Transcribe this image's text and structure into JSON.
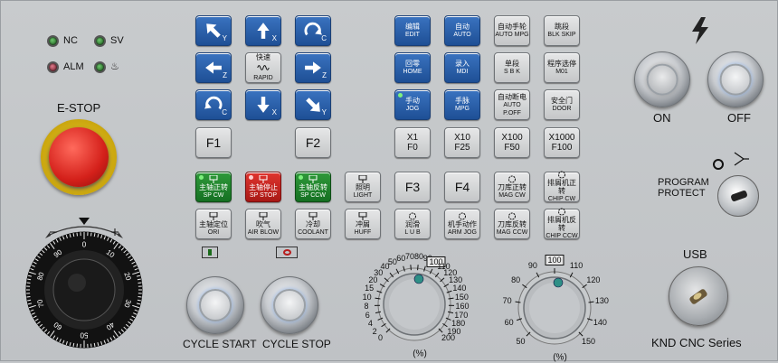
{
  "status_leds": [
    {
      "label": "NC",
      "color": "#2f7a2f"
    },
    {
      "label": "SV",
      "color": "#2f7a2f"
    },
    {
      "label": "ALM",
      "color": "#8a2a3a"
    },
    {
      "label": "♨",
      "color": "#2f7a2f"
    }
  ],
  "estop": {
    "label": "E-STOP"
  },
  "feed_dial_ticks": [
    "0",
    "10",
    "20",
    "30",
    "40",
    "50",
    "60",
    "70",
    "80",
    "90"
  ],
  "cycle": {
    "start_label": "CYCLE START",
    "stop_label": "CYCLE STOP"
  },
  "power": {
    "on_label": "ON",
    "off_label": "OFF"
  },
  "program_protect": {
    "label_line1": "PROGRAM",
    "label_line2": "PROTECT"
  },
  "usb": {
    "label": "USB"
  },
  "brand": {
    "label": "KND CNC Series"
  },
  "jog_keys": [
    {
      "icon": "arrow-up-left",
      "sub": "Y"
    },
    {
      "icon": "arrow-up",
      "sub": "X"
    },
    {
      "icon": "rotate-cw",
      "sub": "C"
    },
    {
      "icon": "arrow-left",
      "sub": "Z"
    },
    {
      "cn": "快速",
      "en": "RAPID",
      "icon": "rapid"
    },
    {
      "icon": "arrow-right",
      "sub": "Z"
    },
    {
      "icon": "rotate-ccw",
      "sub": "C"
    },
    {
      "icon": "arrow-down",
      "sub": "X"
    },
    {
      "icon": "arrow-down-right",
      "sub": "Y"
    }
  ],
  "fkeys": {
    "f1": "F1",
    "f2": "F2",
    "f3": "F3",
    "f4": "F4"
  },
  "mode_keys": [
    {
      "cn": "编辑",
      "en": "EDIT",
      "style": "blue"
    },
    {
      "cn": "自动",
      "en": "AUTO",
      "style": "blue"
    },
    {
      "cn": "自动手轮",
      "en": "AUTO MPG",
      "style": "gray"
    },
    {
      "cn": "跳段",
      "en": "BLK SKIP",
      "style": "gray"
    },
    {
      "cn": "回零",
      "en": "HOME",
      "style": "blue"
    },
    {
      "cn": "录入",
      "en": "MDI",
      "style": "blue"
    },
    {
      "cn": "单段",
      "en": "S B K",
      "style": "gray"
    },
    {
      "cn": "程序选停",
      "en": "M01",
      "style": "gray"
    },
    {
      "cn": "手动",
      "en": "JOG",
      "style": "blue",
      "lit": true
    },
    {
      "cn": "手脉",
      "en": "MPG",
      "style": "blue"
    },
    {
      "cn": "自动断电",
      "en": "AUTO P.OFF",
      "style": "gray"
    },
    {
      "cn": "安全门",
      "en": "DOOR",
      "style": "gray"
    }
  ],
  "rapid_rate_keys": [
    {
      "top": "X1",
      "bot": "F0"
    },
    {
      "top": "X10",
      "bot": "F25"
    },
    {
      "top": "X100",
      "bot": "F50"
    },
    {
      "top": "X1000",
      "bot": "F100"
    }
  ],
  "spindle_keys": [
    {
      "cn": "主轴正转",
      "en": "SP CW",
      "style": "green"
    },
    {
      "cn": "主轴停止",
      "en": "SP STOP",
      "style": "red"
    },
    {
      "cn": "主轴反转",
      "en": "SP CCW",
      "style": "green"
    },
    {
      "cn": "照明",
      "en": "LIGHT",
      "style": "gray"
    },
    {
      "cn": "主轴定位",
      "en": "ORI",
      "style": "gray"
    },
    {
      "cn": "吹气",
      "en": "AIR BLOW",
      "style": "gray"
    },
    {
      "cn": "冷却",
      "en": "COOLANT",
      "style": "gray"
    },
    {
      "cn": "冲屑",
      "en": "HUFF",
      "style": "gray"
    }
  ],
  "aux_keys": [
    {
      "cn": "刀库正转",
      "en": "MAG CW"
    },
    {
      "cn": "排屑机正转",
      "en": "CHIP CW"
    },
    {
      "cn": "润滑",
      "en": "L U B"
    },
    {
      "cn": "机手动作",
      "en": "ARM JOG"
    },
    {
      "cn": "刀库反转",
      "en": "MAG CCW"
    },
    {
      "cn": "排屑机反转",
      "en": "CHIP CCW"
    }
  ],
  "feed_override": {
    "ticks": [
      "0",
      "2",
      "4",
      "6",
      "8",
      "10",
      "15",
      "20",
      "30",
      "40",
      "50",
      "60",
      "70",
      "80",
      "90",
      "100",
      "110",
      "120",
      "130",
      "140",
      "150",
      "160",
      "170",
      "180",
      "190",
      "200"
    ],
    "unit": "(%)",
    "boxed": "100"
  },
  "spindle_override": {
    "ticks": [
      "50",
      "60",
      "70",
      "80",
      "90",
      "100",
      "110",
      "120",
      "130",
      "140",
      "150"
    ],
    "unit": "(%)",
    "boxed": "100"
  }
}
